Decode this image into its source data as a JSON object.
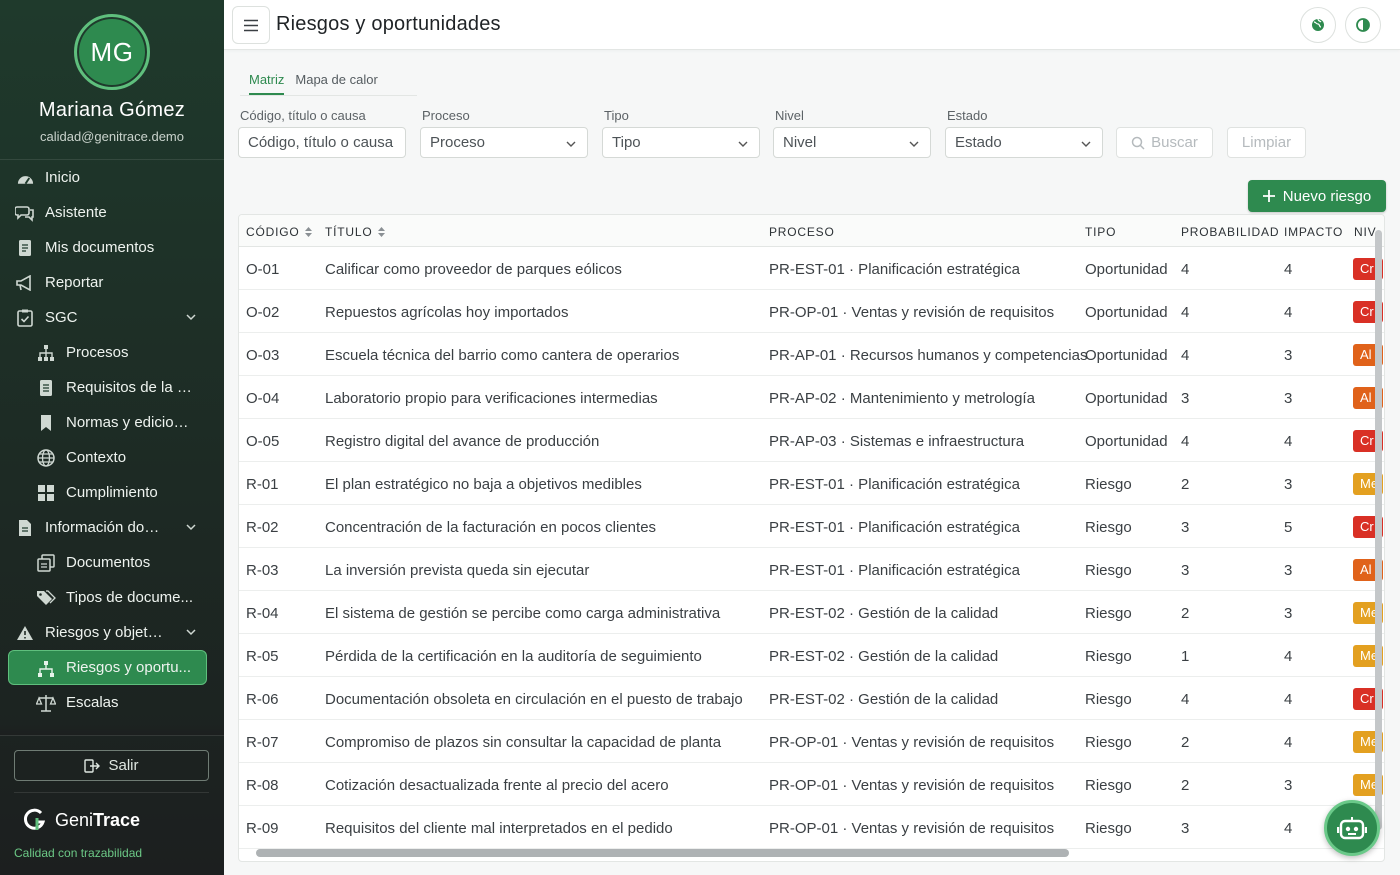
{
  "user": {
    "initials": "MG",
    "name": "Mariana Gómez",
    "email": "calidad@genitrace.demo"
  },
  "nav": {
    "inicio": "Inicio",
    "asistente": "Asistente",
    "mis_documentos": "Mis documentos",
    "reportar": "Reportar",
    "sgc": "SGC",
    "procesos": "Procesos",
    "requisitos": "Requisitos de la n...",
    "normas": "Normas y edicion...",
    "contexto": "Contexto",
    "cumplimiento": "Cumplimiento",
    "informacion": "Información doc...",
    "documentos": "Documentos",
    "tipos": "Tipos de docume...",
    "riesgos_group": "Riesgos y objeti...",
    "riesgos_oport": "Riesgos y oportu...",
    "escalas": "Escalas"
  },
  "logout_label": "Salir",
  "brand": {
    "name_a": "Geni",
    "name_b": "Trace",
    "tagline": "Calidad con trazabilidad"
  },
  "header": {
    "title": "Riesgos y oportunidades"
  },
  "tabs": [
    "Matriz",
    "Mapa de calor"
  ],
  "filters": {
    "codigo_label": "Código, título o causa",
    "codigo_placeholder": "Código, título o causa",
    "proceso_label": "Proceso",
    "proceso_value": "Proceso",
    "tipo_label": "Tipo",
    "tipo_value": "Tipo",
    "nivel_label": "Nivel",
    "nivel_value": "Nivel",
    "estado_label": "Estado",
    "estado_value": "Estado",
    "buscar": "Buscar",
    "limpiar": "Limpiar"
  },
  "new_button": "Nuevo riesgo",
  "colors": {
    "accent": "#2e8a4f",
    "critico": "#d93025",
    "alto": "#e0621a",
    "medio": "#e3a020"
  },
  "table": {
    "headers": [
      "CÓDIGO",
      "TÍTULO",
      "PROCESO",
      "TIPO",
      "PROBABILIDAD",
      "IMPACTO",
      "NIV"
    ],
    "rows": [
      {
        "codigo": "O-01",
        "titulo": "Calificar como proveedor de parques eólicos",
        "proceso": "PR-EST-01 · Planificación estratégica",
        "tipo": "Oportunidad",
        "prob": "4",
        "imp": "4",
        "nivel": "Cr",
        "nivel_color": "crit"
      },
      {
        "codigo": "O-02",
        "titulo": "Repuestos agrícolas hoy importados",
        "proceso": "PR-OP-01 · Ventas y revisión de requisitos",
        "tipo": "Oportunidad",
        "prob": "4",
        "imp": "4",
        "nivel": "Cr",
        "nivel_color": "crit"
      },
      {
        "codigo": "O-03",
        "titulo": "Escuela técnica del barrio como cantera de operarios",
        "proceso": "PR-AP-01 · Recursos humanos y competencias",
        "tipo": "Oportunidad",
        "prob": "4",
        "imp": "3",
        "nivel": "Al",
        "nivel_color": "alto"
      },
      {
        "codigo": "O-04",
        "titulo": "Laboratorio propio para verificaciones intermedias",
        "proceso": "PR-AP-02 · Mantenimiento y metrología",
        "tipo": "Oportunidad",
        "prob": "3",
        "imp": "3",
        "nivel": "Al",
        "nivel_color": "alto"
      },
      {
        "codigo": "O-05",
        "titulo": "Registro digital del avance de producción",
        "proceso": "PR-AP-03 · Sistemas e infraestructura",
        "tipo": "Oportunidad",
        "prob": "4",
        "imp": "4",
        "nivel": "Cr",
        "nivel_color": "crit"
      },
      {
        "codigo": "R-01",
        "titulo": "El plan estratégico no baja a objetivos medibles",
        "proceso": "PR-EST-01 · Planificación estratégica",
        "tipo": "Riesgo",
        "prob": "2",
        "imp": "3",
        "nivel": "Me",
        "nivel_color": "med"
      },
      {
        "codigo": "R-02",
        "titulo": "Concentración de la facturación en pocos clientes",
        "proceso": "PR-EST-01 · Planificación estratégica",
        "tipo": "Riesgo",
        "prob": "3",
        "imp": "5",
        "nivel": "Cr",
        "nivel_color": "crit"
      },
      {
        "codigo": "R-03",
        "titulo": "La inversión prevista queda sin ejecutar",
        "proceso": "PR-EST-01 · Planificación estratégica",
        "tipo": "Riesgo",
        "prob": "3",
        "imp": "3",
        "nivel": "Al",
        "nivel_color": "alto"
      },
      {
        "codigo": "R-04",
        "titulo": "El sistema de gestión se percibe como carga administrativa",
        "proceso": "PR-EST-02 · Gestión de la calidad",
        "tipo": "Riesgo",
        "prob": "2",
        "imp": "3",
        "nivel": "Me",
        "nivel_color": "med"
      },
      {
        "codigo": "R-05",
        "titulo": "Pérdida de la certificación en la auditoría de seguimiento",
        "proceso": "PR-EST-02 · Gestión de la calidad",
        "tipo": "Riesgo",
        "prob": "1",
        "imp": "4",
        "nivel": "Me",
        "nivel_color": "med"
      },
      {
        "codigo": "R-06",
        "titulo": "Documentación obsoleta en circulación en el puesto de trabajo",
        "proceso": "PR-EST-02 · Gestión de la calidad",
        "tipo": "Riesgo",
        "prob": "4",
        "imp": "4",
        "nivel": "Cr",
        "nivel_color": "crit"
      },
      {
        "codigo": "R-07",
        "titulo": "Compromiso de plazos sin consultar la capacidad de planta",
        "proceso": "PR-OP-01 · Ventas y revisión de requisitos",
        "tipo": "Riesgo",
        "prob": "2",
        "imp": "4",
        "nivel": "Me",
        "nivel_color": "med"
      },
      {
        "codigo": "R-08",
        "titulo": "Cotización desactualizada frente al precio del acero",
        "proceso": "PR-OP-01 · Ventas y revisión de requisitos",
        "tipo": "Riesgo",
        "prob": "2",
        "imp": "3",
        "nivel": "Me",
        "nivel_color": "med"
      },
      {
        "codigo": "R-09",
        "titulo": "Requisitos del cliente mal interpretados en el pedido",
        "proceso": "PR-OP-01 · Ventas y revisión de requisitos",
        "tipo": "Riesgo",
        "prob": "3",
        "imp": "4",
        "nivel": "",
        "nivel_color": ""
      }
    ]
  }
}
